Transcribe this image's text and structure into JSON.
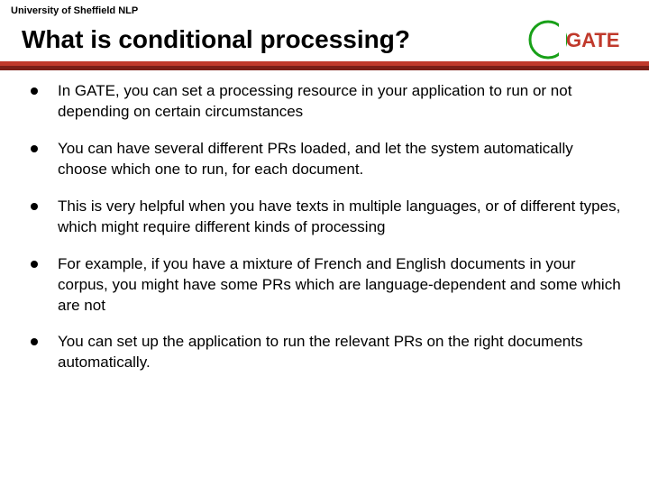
{
  "header": {
    "affiliation": "University of Sheffield NLP",
    "title": "What is conditional processing?",
    "logo_text": "GATE"
  },
  "bullets": [
    "In GATE, you can set a processing resource in your application to run or not depending on certain circumstances",
    "You can have several different PRs loaded, and let the system automatically choose which one to run, for each document.",
    "This is very helpful when you have texts in multiple languages, or of different types, which might require different kinds of processing",
    "For example, if you have a mixture of French and English documents in your corpus, you might have some PRs which are language-dependent and some which are not",
    "You can set up the application to run the relevant PRs on the right documents automatically."
  ]
}
